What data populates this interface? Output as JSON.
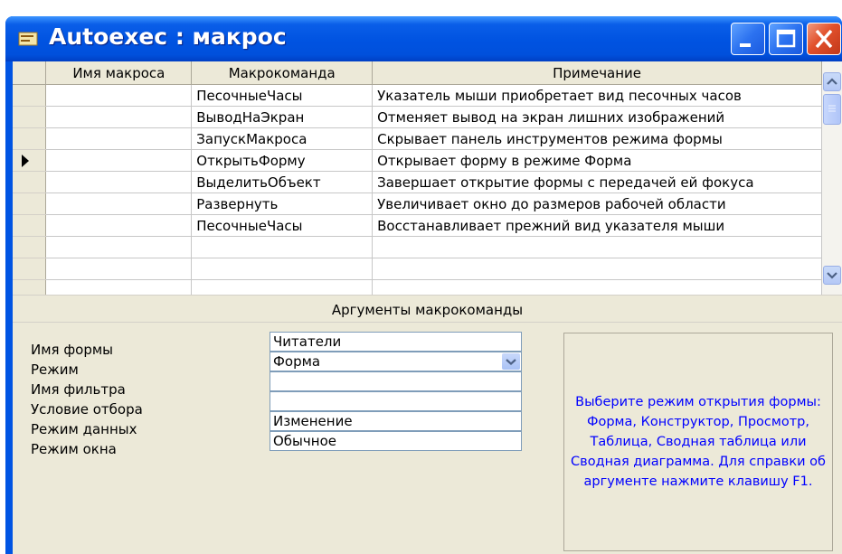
{
  "window": {
    "title": "Autoexec : макрос"
  },
  "grid": {
    "headers": [
      "Имя макроса",
      "Макрокоманда",
      "Примечание"
    ],
    "rows": [
      {
        "name": "",
        "action": "ПесочныеЧасы",
        "comment": "Указатель мыши приобретает вид песочных часов"
      },
      {
        "name": "",
        "action": "ВыводНаЭкран",
        "comment": "Отменяет вывод на экран лишних изображений"
      },
      {
        "name": "",
        "action": "ЗапускМакроса",
        "comment": "Скрывает панель инструментов режима формы"
      },
      {
        "name": "",
        "action": "ОткрытьФорму",
        "comment": "Открывает форму в режиме Форма"
      },
      {
        "name": "",
        "action": "ВыделитьОбъект",
        "comment": "Завершает открытие формы с передачей ей фокуса"
      },
      {
        "name": "",
        "action": "Развернуть",
        "comment": "Увеличивает окно до размеров рабочей области"
      },
      {
        "name": "",
        "action": "ПесочныеЧасы",
        "comment": "Восстанавливает прежний вид указателя мыши"
      }
    ]
  },
  "arguments": {
    "title": "Аргументы макрокоманды",
    "fields": [
      {
        "label": "Имя формы",
        "value": "Читатели"
      },
      {
        "label": "Режим",
        "value": "Форма"
      },
      {
        "label": "Имя фильтра",
        "value": ""
      },
      {
        "label": "Условие отбора",
        "value": ""
      },
      {
        "label": "Режим данных",
        "value": "Изменение"
      },
      {
        "label": "Режим окна",
        "value": "Обычное"
      }
    ],
    "help_text": "Выберите режим открытия формы: Форма, Конструктор, Просмотр, Таблица, Сводная таблица или Сводная диаграмма. Для справки об аргументе нажмите клавишу F1."
  }
}
